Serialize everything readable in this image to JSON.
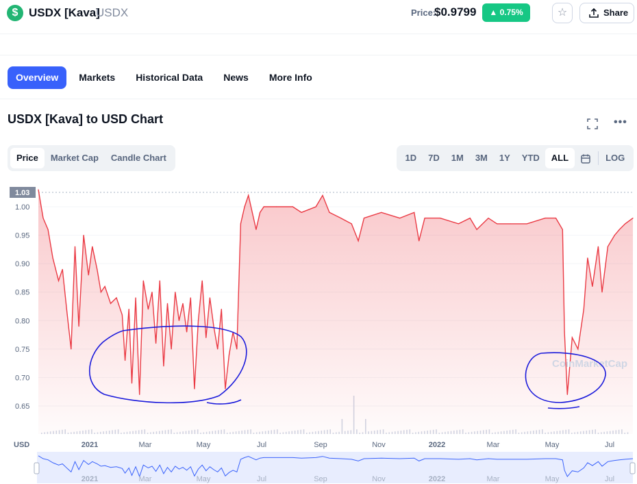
{
  "header": {
    "coin_name": "USDX [Kava]",
    "coin_symbol": "USDX",
    "price_label": "Price:",
    "price_value": "$0.9799",
    "change_badge": "0.75%",
    "share_label": "Share"
  },
  "tabs": [
    {
      "label": "Overview",
      "active": true
    },
    {
      "label": "Markets"
    },
    {
      "label": "Historical Data"
    },
    {
      "label": "News"
    },
    {
      "label": "More Info"
    }
  ],
  "chart_title": "USDX [Kava] to USD Chart",
  "chart_type_options": [
    {
      "label": "Price",
      "active": true
    },
    {
      "label": "Market Cap"
    },
    {
      "label": "Candle Chart"
    }
  ],
  "range_options": [
    {
      "label": "1D"
    },
    {
      "label": "7D"
    },
    {
      "label": "1M"
    },
    {
      "label": "3M"
    },
    {
      "label": "1Y"
    },
    {
      "label": "YTD"
    },
    {
      "label": "ALL",
      "active": true
    }
  ],
  "log_label": "LOG",
  "watermark": "CoinMarketCap",
  "colors": {
    "accent": "#3861fb",
    "up": "#16c784",
    "price_line": "#ea3943",
    "annotation": "#1a1adb",
    "navigator": "#3861fb"
  },
  "chart_data": {
    "type": "area",
    "y_axis_label": "USD",
    "current_price_tag": "1.03",
    "ylim": [
      0.62,
      1.04
    ],
    "yticks": [
      "1.00",
      "0.95",
      "0.90",
      "0.85",
      "0.80",
      "0.75",
      "0.70",
      "0.65"
    ],
    "xticks": [
      "2021",
      "Mar",
      "May",
      "Jul",
      "Sep",
      "Nov",
      "2022",
      "Mar",
      "May",
      "Jul"
    ],
    "x_start": "2020-11-10",
    "x_end": "2022-07-20",
    "series": [
      {
        "points": [
          [
            "2020-11-10",
            1.03
          ],
          [
            "2020-11-15",
            0.98
          ],
          [
            "2020-11-20",
            0.96
          ],
          [
            "2020-11-25",
            0.91
          ],
          [
            "2020-12-01",
            0.87
          ],
          [
            "2020-12-05",
            0.89
          ],
          [
            "2020-12-10",
            0.81
          ],
          [
            "2020-12-14",
            0.75
          ],
          [
            "2020-12-18",
            0.93
          ],
          [
            "2020-12-22",
            0.79
          ],
          [
            "2020-12-27",
            0.95
          ],
          [
            "2021-01-01",
            0.88
          ],
          [
            "2021-01-05",
            0.93
          ],
          [
            "2021-01-10",
            0.89
          ],
          [
            "2021-01-14",
            0.85
          ],
          [
            "2021-01-18",
            0.86
          ],
          [
            "2021-01-24",
            0.83
          ],
          [
            "2021-01-30",
            0.84
          ],
          [
            "2021-02-05",
            0.81
          ],
          [
            "2021-02-08",
            0.73
          ],
          [
            "2021-02-12",
            0.82
          ],
          [
            "2021-02-15",
            0.69
          ],
          [
            "2021-02-19",
            0.84
          ],
          [
            "2021-02-23",
            0.67
          ],
          [
            "2021-02-27",
            0.87
          ],
          [
            "2021-03-04",
            0.82
          ],
          [
            "2021-03-08",
            0.85
          ],
          [
            "2021-03-12",
            0.76
          ],
          [
            "2021-03-16",
            0.87
          ],
          [
            "2021-03-20",
            0.72
          ],
          [
            "2021-03-24",
            0.83
          ],
          [
            "2021-03-28",
            0.75
          ],
          [
            "2021-04-01",
            0.85
          ],
          [
            "2021-04-05",
            0.8
          ],
          [
            "2021-04-09",
            0.83
          ],
          [
            "2021-04-13",
            0.78
          ],
          [
            "2021-04-17",
            0.84
          ],
          [
            "2021-04-21",
            0.68
          ],
          [
            "2021-04-25",
            0.8
          ],
          [
            "2021-04-29",
            0.87
          ],
          [
            "2021-05-03",
            0.77
          ],
          [
            "2021-05-07",
            0.84
          ],
          [
            "2021-05-11",
            0.79
          ],
          [
            "2021-05-15",
            0.75
          ],
          [
            "2021-05-19",
            0.82
          ],
          [
            "2021-05-23",
            0.68
          ],
          [
            "2021-05-27",
            0.74
          ],
          [
            "2021-05-31",
            0.78
          ],
          [
            "2021-06-04",
            0.75
          ],
          [
            "2021-06-08",
            0.97
          ],
          [
            "2021-06-12",
            1.0
          ],
          [
            "2021-06-16",
            1.02
          ],
          [
            "2021-06-20",
            0.99
          ],
          [
            "2021-06-24",
            0.96
          ],
          [
            "2021-06-28",
            0.99
          ],
          [
            "2021-07-02",
            1.0
          ],
          [
            "2021-07-15",
            1.0
          ],
          [
            "2021-08-01",
            1.0
          ],
          [
            "2021-08-10",
            0.99
          ],
          [
            "2021-08-25",
            1.0
          ],
          [
            "2021-09-01",
            1.02
          ],
          [
            "2021-09-08",
            0.99
          ],
          [
            "2021-09-20",
            0.98
          ],
          [
            "2021-10-01",
            0.97
          ],
          [
            "2021-10-08",
            0.94
          ],
          [
            "2021-10-14",
            0.98
          ],
          [
            "2021-11-01",
            0.99
          ],
          [
            "2021-11-20",
            0.98
          ],
          [
            "2021-12-05",
            0.99
          ],
          [
            "2021-12-10",
            0.94
          ],
          [
            "2021-12-16",
            0.98
          ],
          [
            "2022-01-01",
            0.98
          ],
          [
            "2022-01-20",
            0.97
          ],
          [
            "2022-02-01",
            0.98
          ],
          [
            "2022-02-08",
            0.96
          ],
          [
            "2022-02-20",
            0.98
          ],
          [
            "2022-03-01",
            0.97
          ],
          [
            "2022-03-15",
            0.97
          ],
          [
            "2022-04-01",
            0.97
          ],
          [
            "2022-04-20",
            0.98
          ],
          [
            "2022-05-01",
            0.98
          ],
          [
            "2022-05-08",
            0.96
          ],
          [
            "2022-05-10",
            0.78
          ],
          [
            "2022-05-13",
            0.67
          ],
          [
            "2022-05-18",
            0.77
          ],
          [
            "2022-05-24",
            0.75
          ],
          [
            "2022-05-30",
            0.82
          ],
          [
            "2022-06-03",
            0.91
          ],
          [
            "2022-06-08",
            0.86
          ],
          [
            "2022-06-14",
            0.93
          ],
          [
            "2022-06-18",
            0.85
          ],
          [
            "2022-06-24",
            0.93
          ],
          [
            "2022-07-01",
            0.95
          ],
          [
            "2022-07-06",
            0.96
          ],
          [
            "2022-07-12",
            0.97
          ],
          [
            "2022-07-20",
            0.98
          ]
        ]
      }
    ]
  }
}
